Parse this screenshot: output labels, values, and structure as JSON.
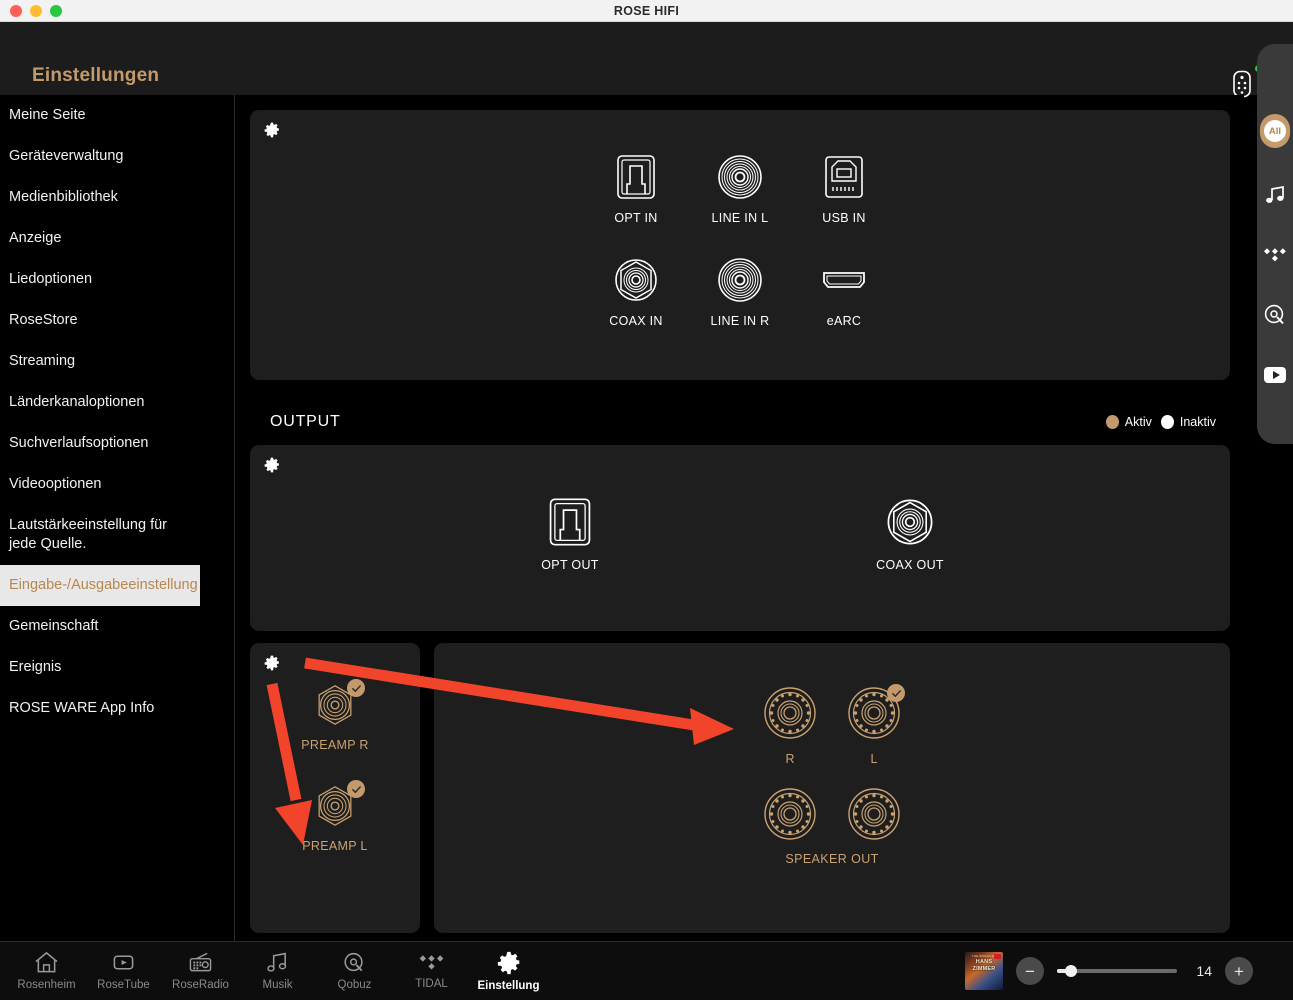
{
  "window": {
    "title": "ROSE HIFI",
    "traffic_lights": [
      "close",
      "minimize",
      "maximize"
    ]
  },
  "header": {
    "title": "Einstellungen",
    "remote_icon": "remote-control-icon",
    "status_dot_color": "#30c93e"
  },
  "sidebar": {
    "items": [
      {
        "label": "Meine Seite",
        "selected": false
      },
      {
        "label": "Geräteverwaltung",
        "selected": false
      },
      {
        "label": "Medienbibliothek",
        "selected": false
      },
      {
        "label": "Anzeige",
        "selected": false
      },
      {
        "label": "Liedoptionen",
        "selected": false
      },
      {
        "label": "RoseStore",
        "selected": false
      },
      {
        "label": "Streaming",
        "selected": false
      },
      {
        "label": "Länderkanaloptionen",
        "selected": false
      },
      {
        "label": "Suchverlaufsoptionen",
        "selected": false
      },
      {
        "label": "Videooptionen",
        "selected": false
      },
      {
        "label": "Lautstärkeeinstellung für jede Quelle.",
        "selected": false
      },
      {
        "label": "Eingabe-/Ausgabeeinstellung",
        "selected": true
      },
      {
        "label": "Gemeinschaft",
        "selected": false
      },
      {
        "label": "Ereignis",
        "selected": false
      },
      {
        "label": "ROSE WARE App Info",
        "selected": false
      }
    ]
  },
  "main": {
    "input_card": {
      "gear_icon": "gear-icon",
      "row1": [
        {
          "label": "OPT IN",
          "icon": "optical-toslink-icon",
          "active": false
        },
        {
          "label": "LINE IN L",
          "icon": "rca-line-icon",
          "active": false
        },
        {
          "label": "USB IN",
          "icon": "usb-b-icon",
          "active": false
        }
      ],
      "row2": [
        {
          "label": "COAX IN",
          "icon": "coaxial-icon",
          "active": false
        },
        {
          "label": "LINE IN R",
          "icon": "rca-line-icon",
          "active": false
        },
        {
          "label": "eARC",
          "icon": "hdmi-earc-icon",
          "active": false
        }
      ]
    },
    "output_section": {
      "title": "OUTPUT",
      "legend": [
        {
          "label": "Aktiv",
          "color": "#c49a6c"
        },
        {
          "label": "Inaktiv",
          "color": "#ffffff"
        }
      ]
    },
    "digital_card": {
      "gear_icon": "gear-icon",
      "items": [
        {
          "label": "OPT OUT",
          "icon": "optical-toslink-icon",
          "active": false
        },
        {
          "label": "COAX OUT",
          "icon": "coaxial-icon",
          "active": false
        }
      ]
    },
    "preamp_card": {
      "gear_icon": "gear-icon",
      "items": [
        {
          "label": "PREAMP R",
          "icon": "rca-jack-icon",
          "active": true
        },
        {
          "label": "PREAMP L",
          "icon": "rca-jack-icon",
          "active": true
        }
      ]
    },
    "speaker_card": {
      "caption": "SPEAKER OUT",
      "top_row": [
        {
          "label": "R",
          "icon": "binding-post-icon",
          "active": false
        },
        {
          "label": "L",
          "icon": "binding-post-icon",
          "active": true
        }
      ],
      "bottom_row": [
        {
          "label": "",
          "icon": "binding-post-icon",
          "active": false
        },
        {
          "label": "",
          "icon": "binding-post-icon",
          "active": false
        }
      ]
    }
  },
  "rail": {
    "items": [
      {
        "name": "all-badge",
        "label": "All"
      },
      {
        "name": "music-note-icon",
        "label": ""
      },
      {
        "name": "tidal-icon",
        "label": ""
      },
      {
        "name": "qobuz-icon",
        "label": ""
      },
      {
        "name": "youtube-icon",
        "label": ""
      }
    ]
  },
  "bottom_nav": {
    "items": [
      {
        "label": "Rosenheim",
        "icon": "home-icon",
        "active": false
      },
      {
        "label": "RoseTube",
        "icon": "video-icon",
        "active": false
      },
      {
        "label": "RoseRadio",
        "icon": "radio-icon",
        "active": false
      },
      {
        "label": "Musik",
        "icon": "music-note-icon",
        "active": false
      },
      {
        "label": "Qobuz",
        "icon": "qobuz-icon",
        "active": false
      },
      {
        "label": "TIDAL",
        "icon": "tidal-icon",
        "active": false
      },
      {
        "label": "Einstellung",
        "icon": "gear-icon",
        "active": true
      }
    ]
  },
  "player": {
    "album_title": "HANS",
    "album_subtitle": "ZIMMER",
    "album_top_line": "THE WORLD OF",
    "volume": "14",
    "minus_label": "−",
    "plus_label": "+"
  },
  "annotations": {
    "arrow_color": "#f2442a",
    "arrow1": "points from preamp card gear to speaker-out right panel",
    "arrow2": "points from preamp card gear down to PREAMP L"
  }
}
